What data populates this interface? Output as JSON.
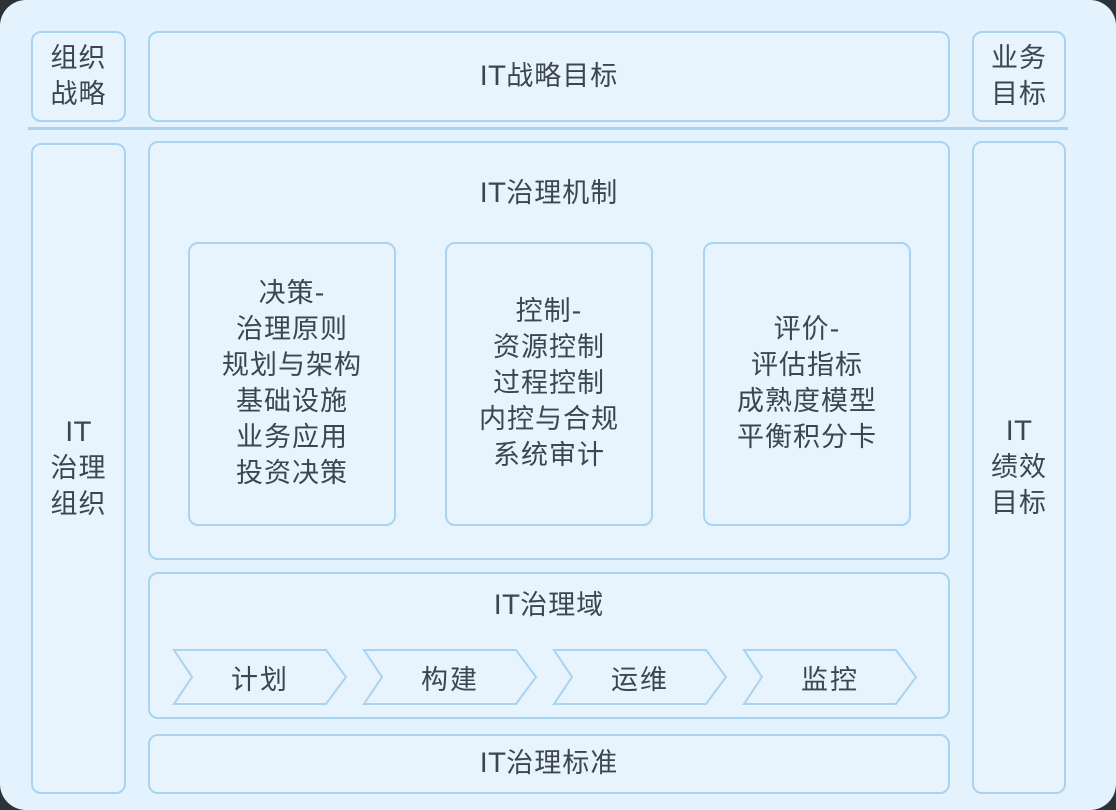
{
  "top": {
    "left": "组织\n战略",
    "center": "IT战略目标",
    "right": "业务\n目标"
  },
  "left_col": "IT\n治理\n组织",
  "right_col": "IT\n绩效\n目标",
  "mechanism": {
    "title": "IT治理机制",
    "decision": "决策-\n治理原则\n规划与架构\n基础设施\n业务应用\n投资决策",
    "control": "控制-\n资源控制\n过程控制\n内控与合规\n系统审计",
    "evaluation": "评价-\n评估指标\n成熟度模型\n平衡积分卡"
  },
  "domain": {
    "title": "IT治理域",
    "steps": [
      "计划",
      "构建",
      "运维",
      "监控"
    ]
  },
  "standard": "IT治理标准",
  "colors": {
    "background": "#e3f2fc",
    "border": "#a9d3f0",
    "text": "#3d4650"
  }
}
